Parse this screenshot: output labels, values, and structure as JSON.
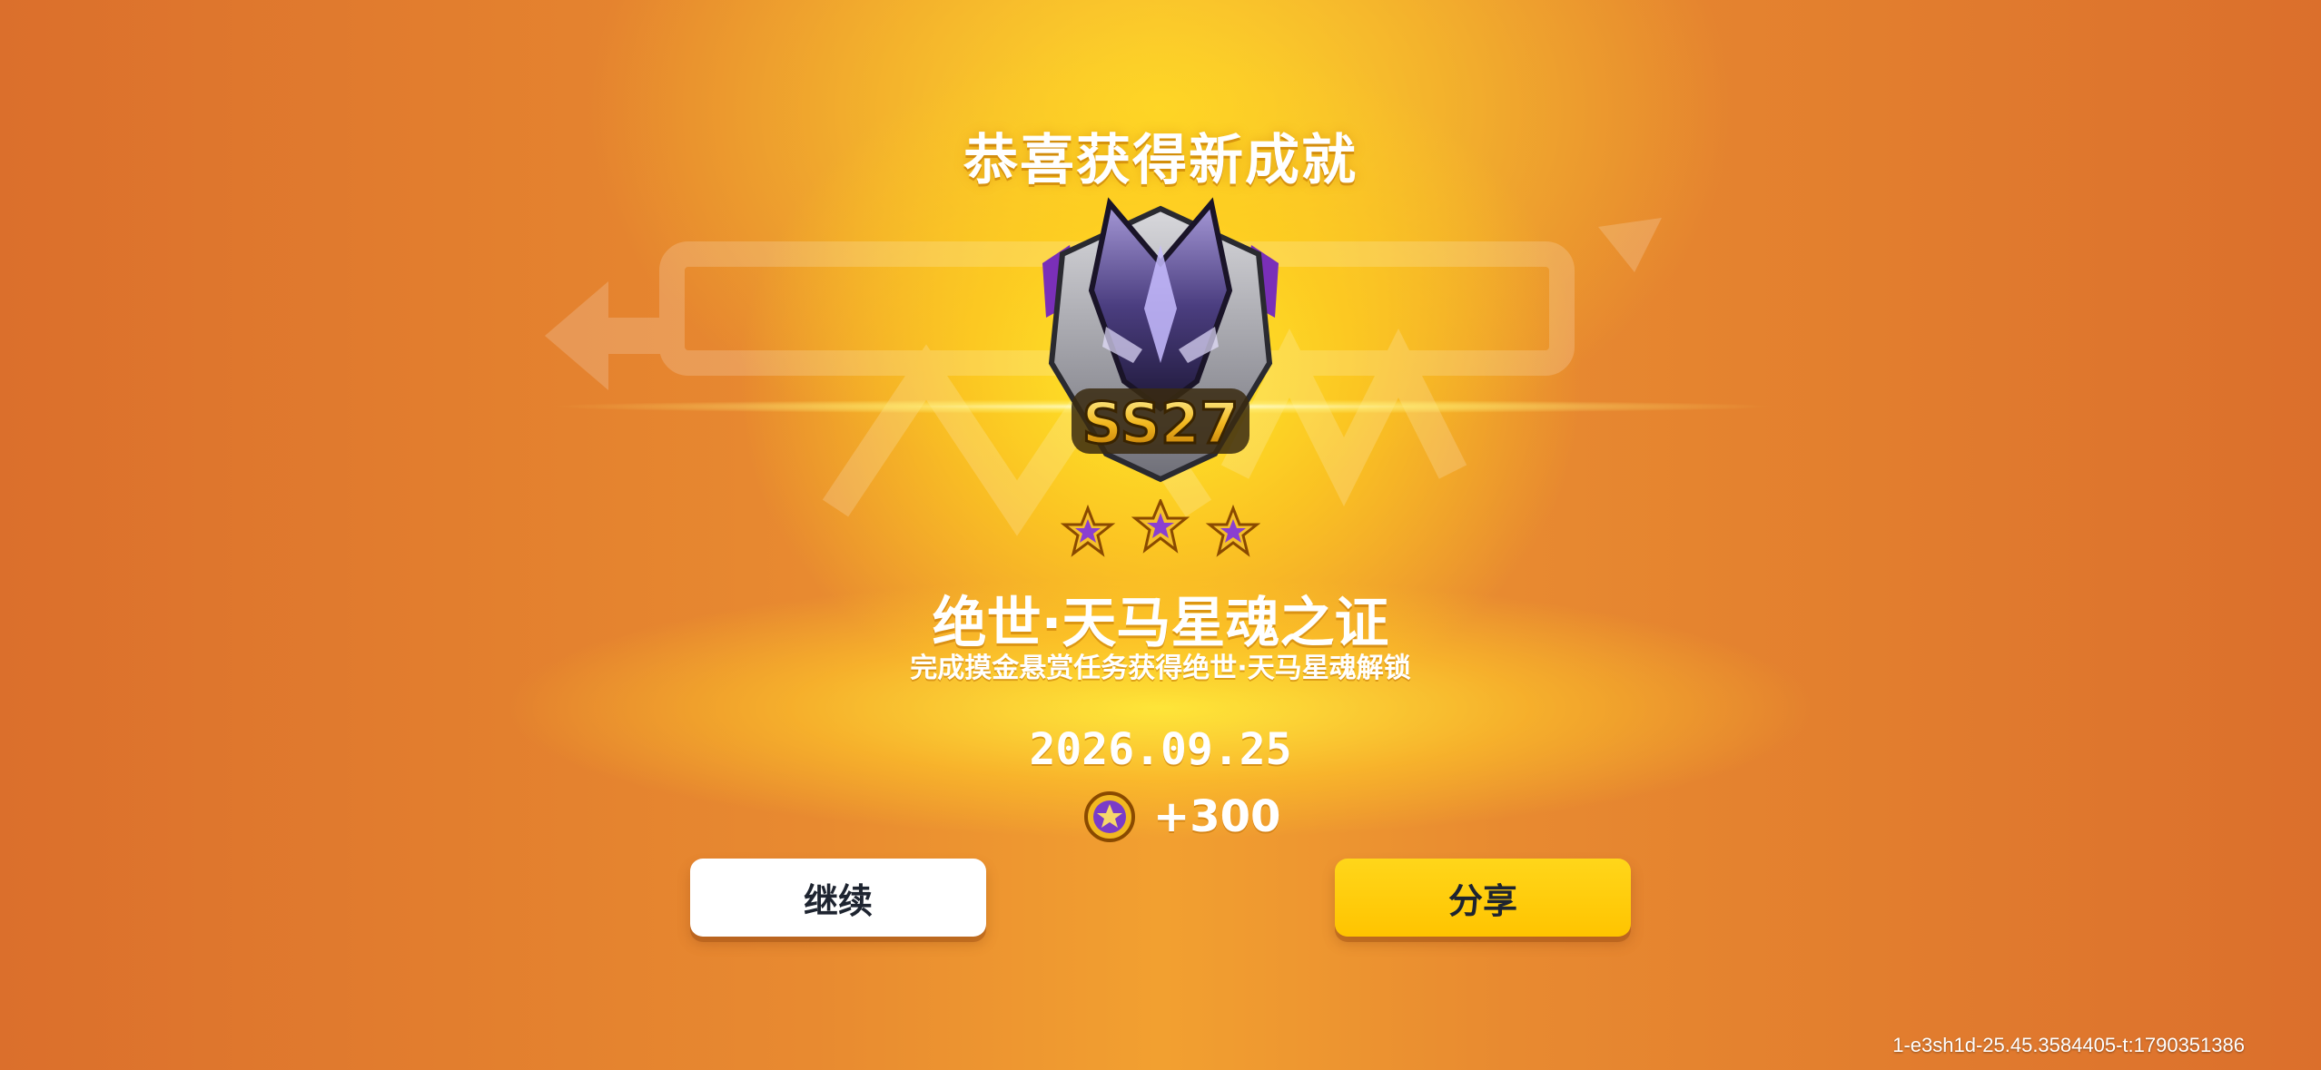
{
  "popup": {
    "title": "恭喜获得新成就",
    "badge_label": "SS27",
    "star_count": 3,
    "achievement_name": "绝世·天马星魂之证",
    "description": "完成摸金悬赏任务获得绝世·天马星魂解锁",
    "date": "2026.09.25",
    "reward_amount": "+300",
    "reward_icon": "star-token-icon"
  },
  "buttons": {
    "continue_label": "继续",
    "share_label": "分享"
  },
  "footer": {
    "build_id": "1-e3sh1d-25.45.3584405-t:1790351386"
  },
  "colors": {
    "background": "#e27a2e",
    "glow": "#ffe028",
    "share_button": "#ffc400",
    "continue_button": "#ffffff",
    "button_text": "#1e2430"
  }
}
